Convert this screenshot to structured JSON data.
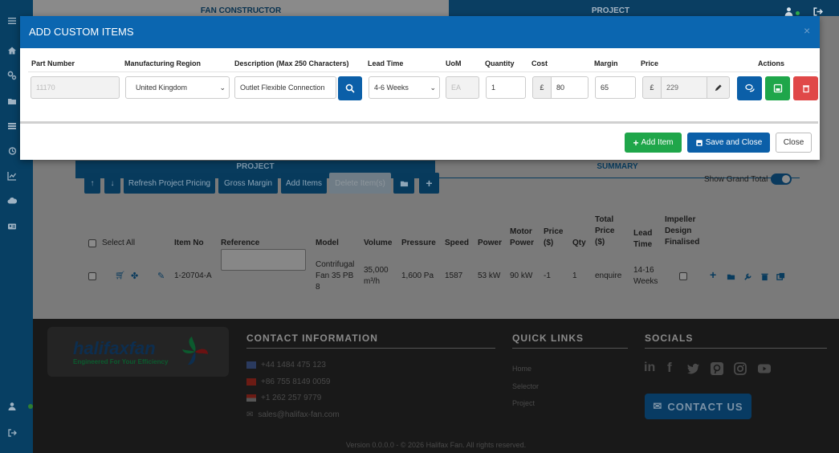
{
  "topnav": {
    "tab_fan_constructor": "FAN CONSTRUCTOR",
    "tab_project": "PROJECT"
  },
  "project_tabs": {
    "project": "PROJECT",
    "summary": "SUMMARY"
  },
  "toolbar": {
    "refresh": "Refresh Project Pricing",
    "gross_margin": "Gross Margin",
    "add_items": "Add Items",
    "delete_items": "Delete Item(s)",
    "show_grand_total": "Show Grand Total"
  },
  "table": {
    "headers": {
      "select_all": "Select All",
      "item_no": "Item No",
      "reference": "Reference",
      "model": "Model",
      "volume": "Volume",
      "pressure": "Pressure",
      "speed": "Speed",
      "power": "Power",
      "motor_power": "Motor Power",
      "price": "Price ($)",
      "qty": "Qty",
      "total_price": "Total Price ($)",
      "lead_time": "Lead Time",
      "impeller": "Impeller Design Finalised"
    },
    "row": {
      "item_no": "1-20704-A",
      "model": "Contrifugal Fan 35 PB 8",
      "volume": "35,000 m³/h",
      "pressure": "1,600 Pa",
      "speed": "1587",
      "power": "53 kW",
      "motor_power": "90 kW",
      "price": "-1",
      "qty": "1",
      "total_price": "enquire",
      "lead_time": "14-16 Weeks"
    }
  },
  "modal": {
    "title": "ADD CUSTOM ITEMS",
    "close_x": "×",
    "columns": {
      "part_number": "Part Number",
      "region": "Manufacturing Region",
      "description": "Description (Max 250 Characters)",
      "lead_time": "Lead Time",
      "uom": "UoM",
      "quantity": "Quantity",
      "cost": "Cost",
      "margin": "Margin",
      "price": "Price",
      "actions": "Actions"
    },
    "values": {
      "part_number": "11170",
      "region": "United Kingdom",
      "description": "Outlet Flexible Connection",
      "lead_time": "4-6 Weeks",
      "uom": "EA",
      "quantity": "1",
      "currency": "£",
      "cost": "80",
      "margin": "65",
      "price": "229"
    },
    "buttons": {
      "add_item": "Add Item",
      "save_close": "Save and Close",
      "close": "Close"
    },
    "colors": {
      "header": "#0b66b0",
      "success": "#1fa64a",
      "danger": "#e04848",
      "primary": "#0b5fa8"
    }
  },
  "footer": {
    "logo_name": "halifaxfan",
    "logo_tagline": "Engineered For Your Efficiency",
    "contact_heading": "CONTACT INFORMATION",
    "phones": [
      "+44 1484 475 123",
      "+86 755 8149 0059",
      "+1 262 257 9779"
    ],
    "email": "sales@halifax-fan.com",
    "quick_links_heading": "QUICK LINKS",
    "quick_links": [
      "Home",
      "Selector",
      "Project"
    ],
    "socials_heading": "SOCIALS",
    "contact_button": "CONTACT US",
    "copyright": "Version 0.0.0.0 - © 2026 Halifax Fan. All rights reserved."
  }
}
